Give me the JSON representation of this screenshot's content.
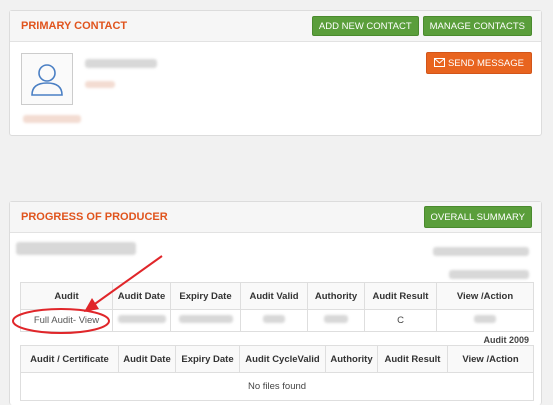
{
  "primary_contact": {
    "title": "PRIMARY CONTACT",
    "add_button": "ADD NEW CONTACT",
    "manage_button": "MANAGE CONTACTS",
    "send_button": "SEND MESSAGE",
    "icons": {
      "avatar": "user-avatar-icon",
      "mail": "envelope-icon"
    }
  },
  "producer_progress": {
    "title": "PROGRESS OF PRODUCER",
    "summary_button": "OVERALL SUMMARY",
    "table1": {
      "headers": [
        "Audit",
        "Audit Date",
        "Expiry Date",
        "Audit Valid",
        "Authority",
        "Audit Result",
        "View /Action"
      ],
      "row": {
        "audit": "Full Audit- View",
        "result": "C"
      }
    },
    "table2": {
      "caption": "Audit 2009",
      "headers": [
        "Audit / Certificate",
        "Audit Date",
        "Expiry Date",
        "Audit CycleValid",
        "Authority",
        "Audit Result",
        "View /Action"
      ],
      "empty": "No files found"
    }
  },
  "colors": {
    "accent_orange": "#e0541d",
    "button_green": "#5a9e3b",
    "button_orange": "#e8641f",
    "annotation_red": "#e0262a"
  }
}
